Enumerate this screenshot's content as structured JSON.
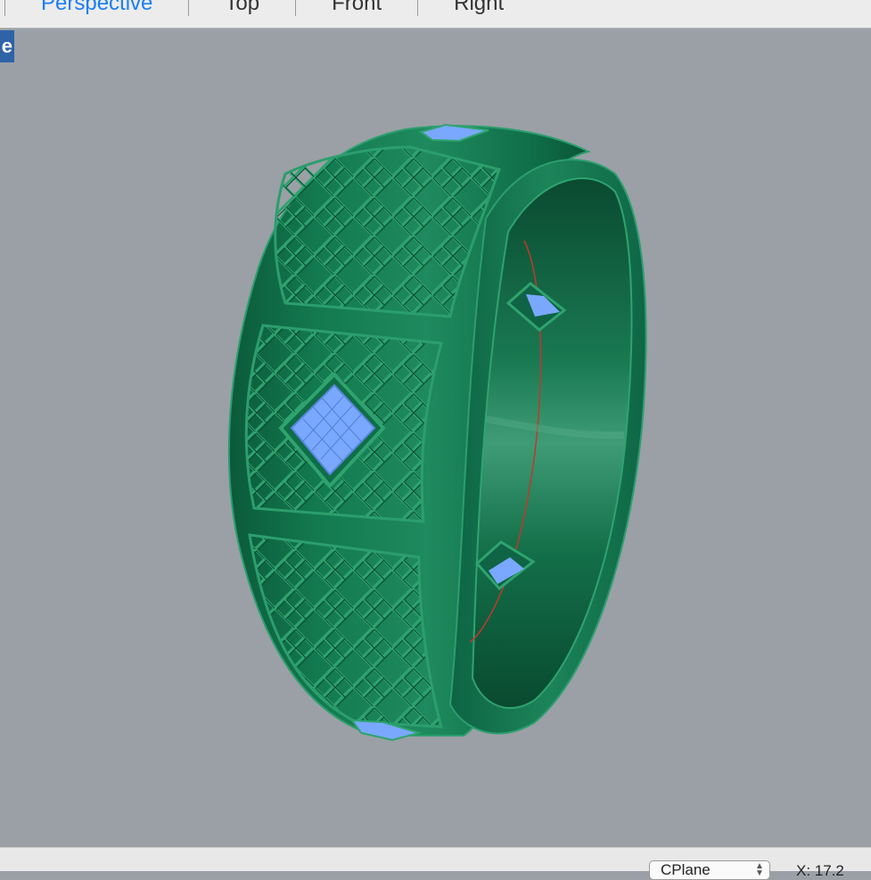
{
  "tabs": [
    {
      "label": "Perspective",
      "active": true
    },
    {
      "label": "Top",
      "active": false
    },
    {
      "label": "Front",
      "active": false
    },
    {
      "label": "Right",
      "active": false
    }
  ],
  "viewport": {
    "label_fragment": "e",
    "background_color": "#9aa0a6",
    "model_color": "#0f6e47",
    "gem_color": "#7aa8ff",
    "curve_color": "#c0392b"
  },
  "status": {
    "cplane_label": "CPlane",
    "coordinate": "X: 17.2"
  }
}
